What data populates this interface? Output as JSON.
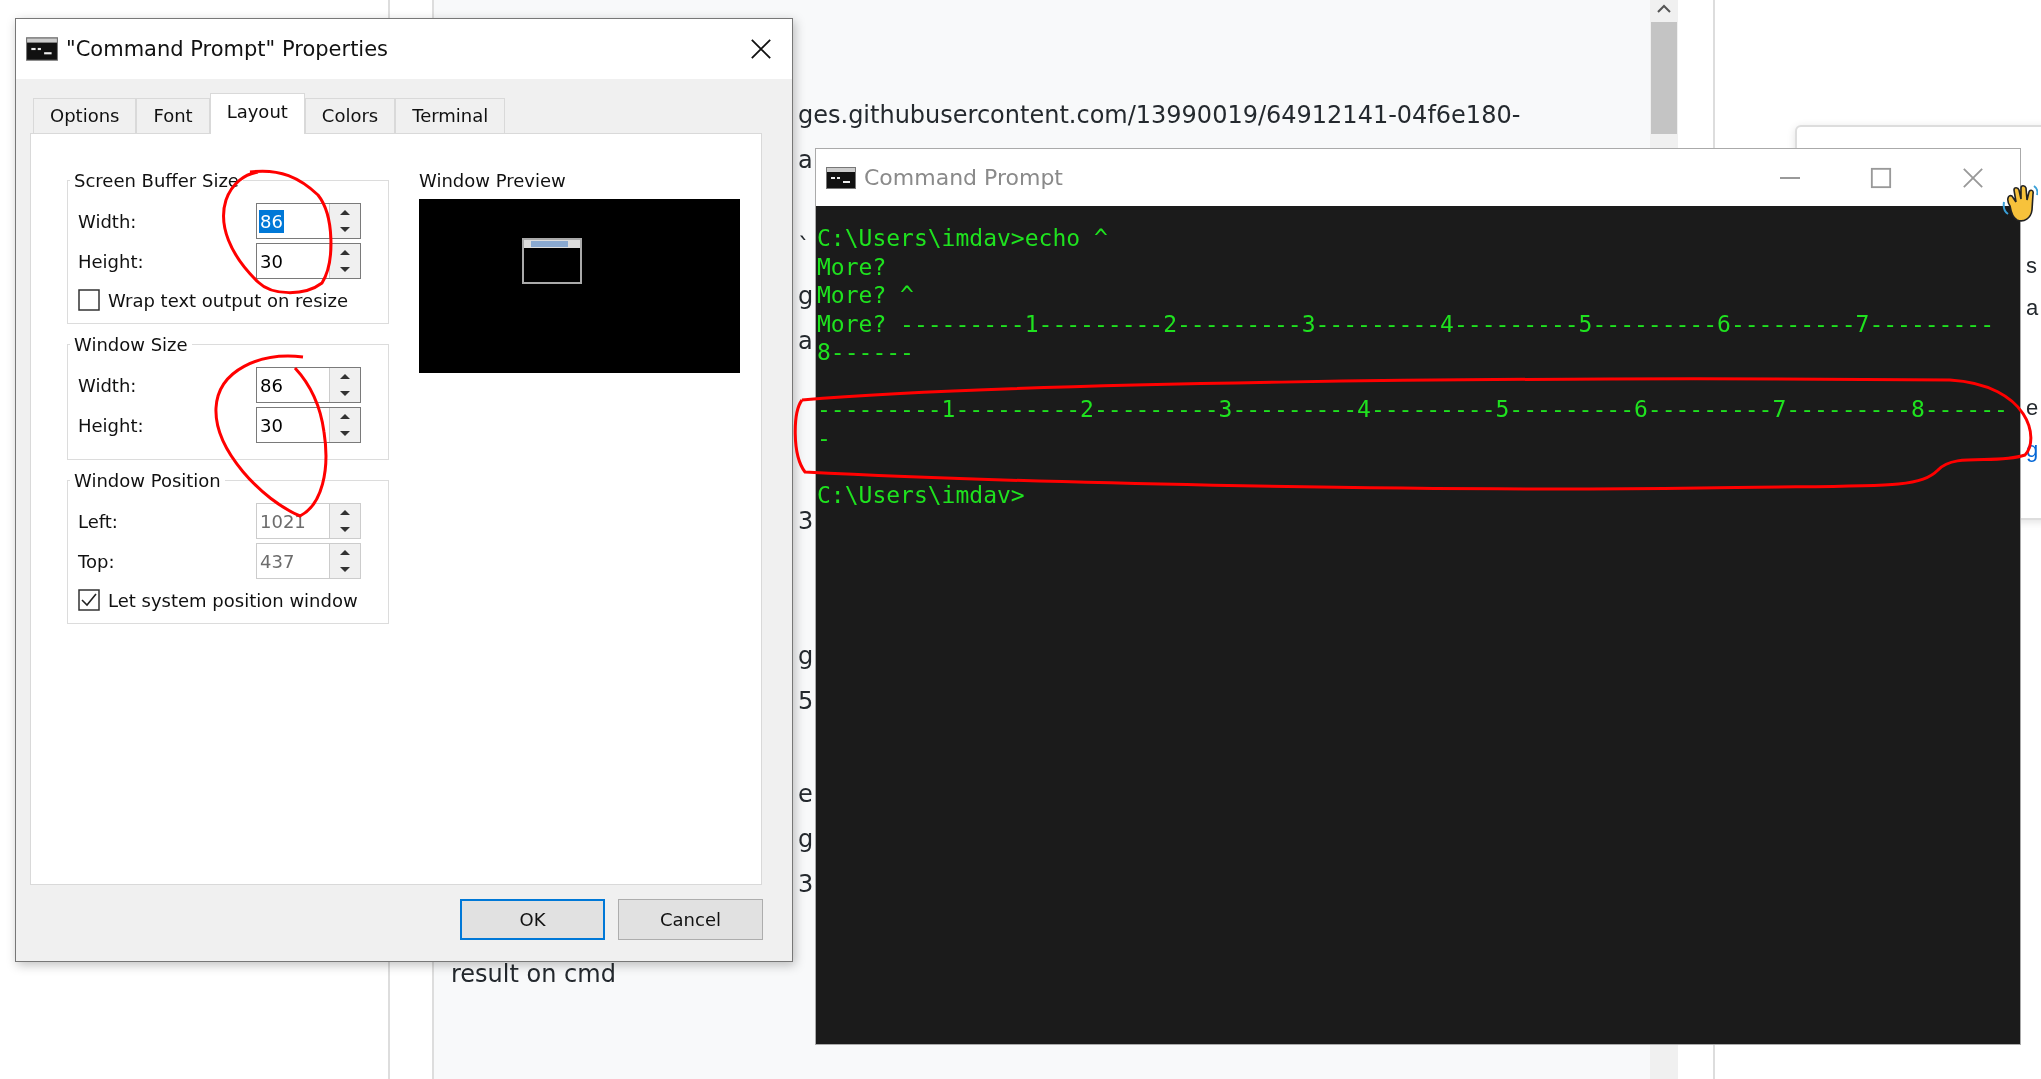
{
  "document": {
    "blocks": [
      [
        "ges.githubusercontent.com/13990019/64912141-04f6e180-",
        "a"
      ],
      [
        "`"
      ],
      [
        "g",
        "a"
      ],
      [
        "3"
      ],
      [
        "g",
        "5"
      ],
      [
        "e",
        "g",
        "3"
      ]
    ],
    "caption": "result on cmd"
  },
  "side_card": {
    "paragraphs": [
      [
        {
          "text": "s",
          "kind": "text"
        },
        {
          "text": "a",
          "kind": "text"
        }
      ],
      [
        {
          "text": "e",
          "kind": "text"
        },
        {
          "text": "g",
          "kind": "link"
        }
      ]
    ]
  },
  "dialog": {
    "title": "\"Command Prompt\" Properties",
    "tabs": [
      {
        "label": "Options",
        "selected": false
      },
      {
        "label": "Font",
        "selected": false
      },
      {
        "label": "Layout",
        "selected": true
      },
      {
        "label": "Colors",
        "selected": false
      },
      {
        "label": "Terminal",
        "selected": false
      }
    ],
    "groups": [
      {
        "title": "Screen Buffer Size",
        "fields": [
          {
            "label": "Width:",
            "value": "86",
            "selected": true,
            "disabled": false
          },
          {
            "label": "Height:",
            "value": "30",
            "selected": false,
            "disabled": false
          }
        ],
        "checkbox": {
          "label": "Wrap text output on resize",
          "checked": false
        }
      },
      {
        "title": "Window Size",
        "fields": [
          {
            "label": "Width:",
            "value": "86",
            "selected": false,
            "disabled": false
          },
          {
            "label": "Height:",
            "value": "30",
            "selected": false,
            "disabled": false
          }
        ]
      },
      {
        "title": "Window Position",
        "fields": [
          {
            "label": "Left:",
            "value": "1021",
            "selected": false,
            "disabled": true
          },
          {
            "label": "Top:",
            "value": "437",
            "selected": false,
            "disabled": true
          }
        ],
        "checkbox": {
          "label": "Let system position window",
          "checked": true
        }
      }
    ],
    "preview": {
      "title": "Window Preview"
    },
    "buttons": [
      {
        "label": "OK",
        "default": true
      },
      {
        "label": "Cancel",
        "default": false
      }
    ]
  },
  "terminal": {
    "title": "Command Prompt",
    "blocks": [
      [
        "C:\\Users\\imdav>echo ^",
        "More?",
        "More? ^",
        "More? ---------1---------2---------3---------4---------5---------6---------7---------",
        "8------"
      ],
      [
        "---------1---------2---------3---------4---------5---------6---------7---------8------",
        "-"
      ],
      [
        "C:\\Users\\imdav>"
      ]
    ]
  }
}
